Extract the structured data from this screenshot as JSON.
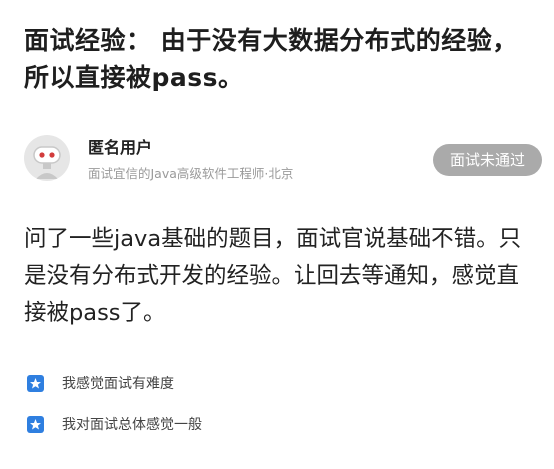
{
  "post": {
    "title": "面试经验： 由于没有大数据分布式的经验，所以直接被pass。",
    "author": {
      "name": "匿名用户",
      "meta": "面试宜信的Java高级软件工程师·北京"
    },
    "status": "面试未通过",
    "content": "问了一些java基础的题目，面试官说基础不错。只是没有分布式开发的经验。让回去等通知，感觉直接被pass了。",
    "tags": [
      {
        "icon": "star-icon",
        "text": "我感觉面试有难度"
      },
      {
        "icon": "star-icon",
        "text": "我对面试总体感觉一般"
      }
    ]
  },
  "colors": {
    "badge_bg": "#aaaaaa",
    "tag_icon": "#2f7fe0",
    "avatar_accent": "#d23c3c"
  }
}
